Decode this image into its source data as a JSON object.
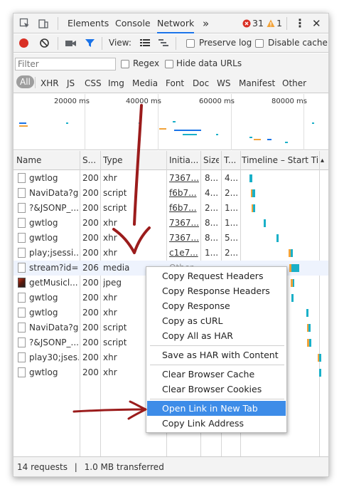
{
  "tabbar": {
    "tabs": [
      "Elements",
      "Console",
      "Network"
    ],
    "active_tab": "Network",
    "error_count": "31",
    "warning_count": "1",
    "more_icon": "chevron-double-right-icon",
    "menu_icon": "vertical-dots-icon",
    "close_icon": "close-icon"
  },
  "toolbar": {
    "view_label": "View:",
    "preserve_log": "Preserve log",
    "disable_cache": "Disable cache"
  },
  "filter": {
    "placeholder": "Filter",
    "regex": "Regex",
    "hide_data_urls": "Hide data URLs",
    "types": [
      "All",
      "XHR",
      "JS",
      "CSS",
      "Img",
      "Media",
      "Font",
      "Doc",
      "WS",
      "Manifest",
      "Other"
    ],
    "active_type": "All"
  },
  "overview": {
    "time_labels": [
      "20000 ms",
      "40000 ms",
      "60000 ms",
      "80000 ms"
    ]
  },
  "table": {
    "columns": [
      "Name",
      "S...",
      "Type",
      "Initia...",
      "Size",
      "T...",
      "Timeline – Start Time"
    ],
    "rows": [
      {
        "name": "gwtlog",
        "status": "200",
        "type": "xhr",
        "initiator": "7367...",
        "size": "8...",
        "time": "4..."
      },
      {
        "name": "NaviData?g...",
        "status": "200",
        "type": "script",
        "initiator": "f6b7...",
        "size": "4...",
        "time": "2..."
      },
      {
        "name": "?&JSONP_...",
        "status": "200",
        "type": "script",
        "initiator": "f6b7...",
        "size": "2...",
        "time": "1..."
      },
      {
        "name": "gwtlog",
        "status": "200",
        "type": "xhr",
        "initiator": "7367...",
        "size": "8...",
        "time": "1..."
      },
      {
        "name": "gwtlog",
        "status": "200",
        "type": "xhr",
        "initiator": "7367...",
        "size": "8...",
        "time": "5..."
      },
      {
        "name": "play;jsessi...",
        "status": "200",
        "type": "xhr",
        "initiator": "c1e7...",
        "size": "1...",
        "time": "2..."
      },
      {
        "name": "stream?id=...",
        "status": "206",
        "type": "media",
        "initiator": "Other",
        "size": "",
        "time": ""
      },
      {
        "name": "getMusicl...",
        "status": "200",
        "type": "jpeg",
        "initiator": "",
        "size": "",
        "time": ""
      },
      {
        "name": "gwtlog",
        "status": "200",
        "type": "xhr",
        "initiator": "",
        "size": "",
        "time": ""
      },
      {
        "name": "gwtlog",
        "status": "200",
        "type": "xhr",
        "initiator": "",
        "size": "",
        "time": ""
      },
      {
        "name": "NaviData?g...",
        "status": "200",
        "type": "script",
        "initiator": "",
        "size": "",
        "time": ""
      },
      {
        "name": "?&JSONP_...",
        "status": "200",
        "type": "script",
        "initiator": "",
        "size": "",
        "time": ""
      },
      {
        "name": "play30;jses...",
        "status": "200",
        "type": "xhr",
        "initiator": "",
        "size": "",
        "time": ""
      },
      {
        "name": "gwtlog",
        "status": "200",
        "type": "xhr",
        "initiator": "",
        "size": "",
        "time": ""
      }
    ]
  },
  "footer": {
    "requests": "14 requests",
    "divider": "|",
    "transferred": "1.0 MB transferred"
  },
  "context_menu": {
    "items": [
      "Copy Request Headers",
      "Copy Response Headers",
      "Copy Response",
      "Copy as cURL",
      "Copy All as HAR",
      "Save as HAR with Content",
      "Clear Browser Cache",
      "Clear Browser Cookies",
      "Open Link in New Tab",
      "Copy Link Address"
    ],
    "highlighted": "Open Link in New Tab"
  },
  "colors": {
    "accent": "#1a73e8",
    "record_red": "#d93025",
    "menu_highlight": "#3d8ce8",
    "annotation_arrow": "#9b1c1c",
    "timeline_bar": "#1ab0c8",
    "timeline_wait": "#f2a33a"
  }
}
